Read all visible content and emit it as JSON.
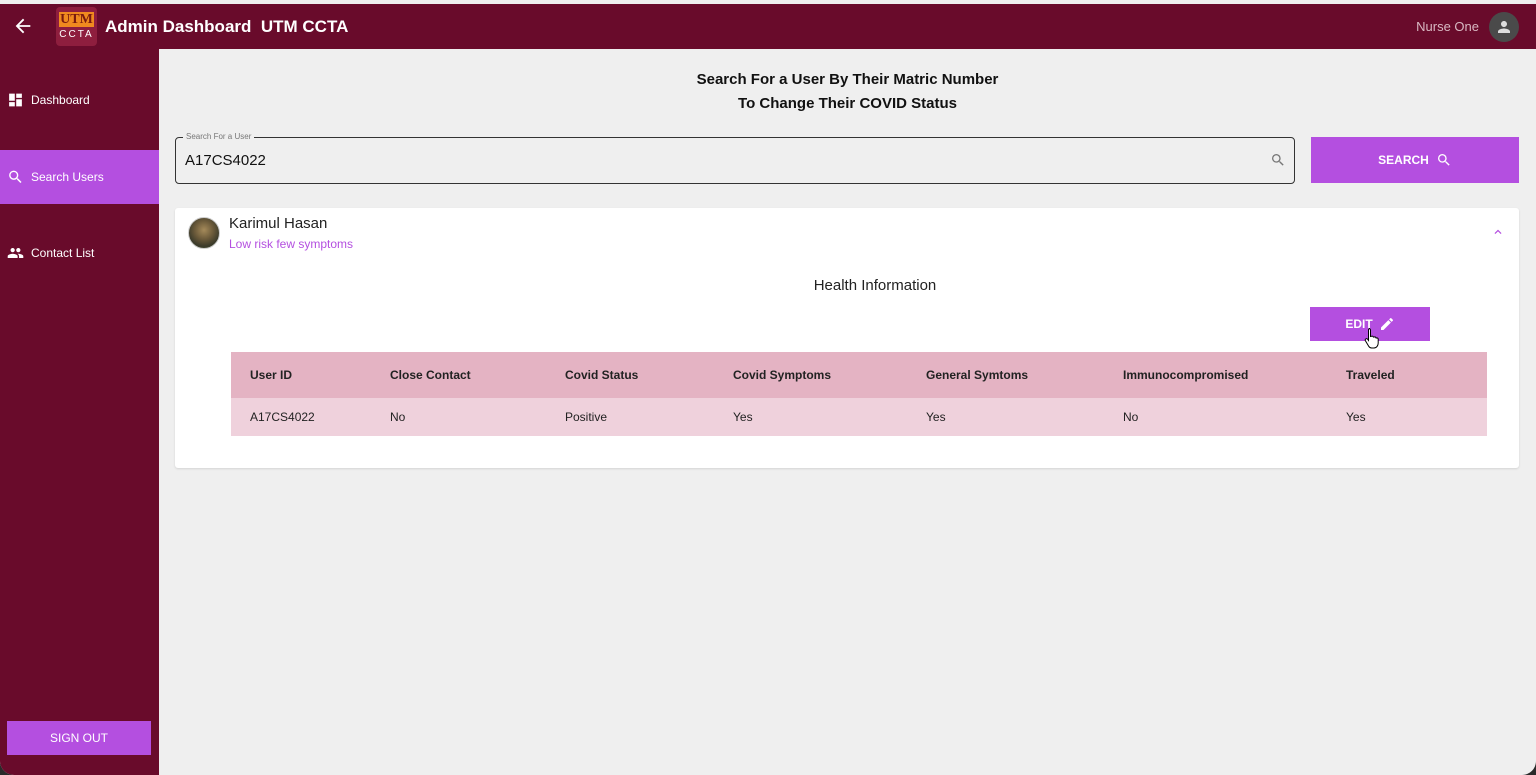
{
  "header": {
    "logo_top": "UTM",
    "logo_bottom": "CCTA",
    "title": "Admin Dashboard  UTM CCTA",
    "user_name": "Nurse One"
  },
  "sidebar": {
    "items": [
      {
        "label": "Dashboard",
        "icon": "dashboard-icon",
        "active": false
      },
      {
        "label": "Search Users",
        "icon": "search-icon",
        "active": true
      },
      {
        "label": "Contact List",
        "icon": "people-icon",
        "active": false
      }
    ],
    "sign_out": "SIGN OUT"
  },
  "main": {
    "heading_line1": "Search For a User By Their Matric Number",
    "heading_line2": "To Change Their COVID Status",
    "search": {
      "legend": "Search For a User",
      "value": "A17CS4022",
      "button_label": "SEARCH"
    },
    "user_card": {
      "name": "Karimul Hasan",
      "subtitle": "Low risk few symptoms",
      "section_title": "Health Information",
      "edit_label": "EDIT",
      "table": {
        "headers": [
          "User ID",
          "Close Contact",
          "Covid Status",
          "Covid Symptoms",
          "General Symtoms",
          "Immunocompromised",
          "Traveled"
        ],
        "rows": [
          [
            "A17CS4022",
            "No",
            "Positive",
            "Yes",
            "Yes",
            "No",
            "Yes"
          ]
        ]
      }
    }
  },
  "colors": {
    "brand": "#690b2b",
    "accent": "#b44fe0",
    "table_header": "#e4b3c3",
    "table_row": "#efd1dc"
  }
}
